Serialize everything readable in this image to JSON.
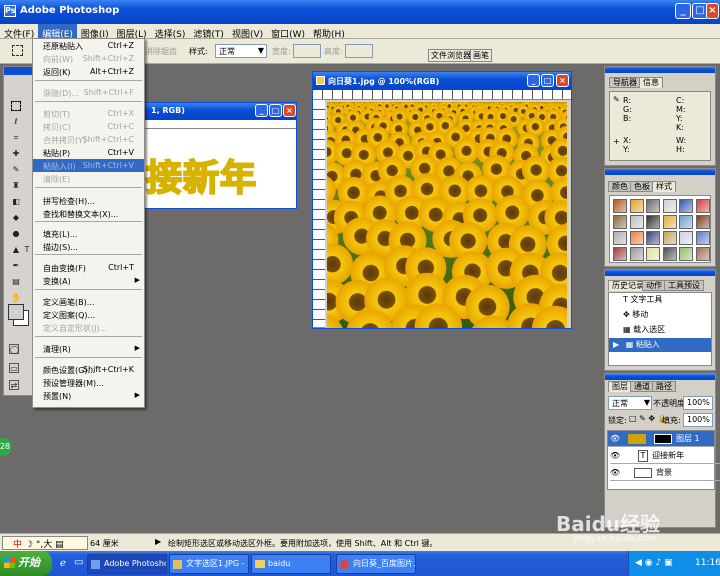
{
  "window": {
    "title": "Adobe Photoshop"
  },
  "menubar": [
    "文件(F)",
    "编辑(E)",
    "图像(I)",
    "图层(L)",
    "选择(S)",
    "滤镜(T)",
    "视图(V)",
    "窗口(W)",
    "帮助(H)"
  ],
  "options": {
    "feather_label": "消除锯齿",
    "style_label": "样式:",
    "style_value": "正常",
    "width_label": "宽度:",
    "height_label": "高度:",
    "tab1": "文件浏览器",
    "tab2": "画笔"
  },
  "edit_menu": [
    {
      "label": "还原粘贴入",
      "shortcut": "Ctrl+Z",
      "state": "normal"
    },
    {
      "label": "向前(W)",
      "shortcut": "Shift+Ctrl+Z",
      "state": "disabled"
    },
    {
      "label": "返回(K)",
      "shortcut": "Alt+Ctrl+Z",
      "state": "normal"
    },
    {
      "label": "渐隐(D)...",
      "shortcut": "Shift+Ctrl+F",
      "state": "disabled"
    },
    {
      "label": "剪切(T)",
      "shortcut": "Ctrl+X",
      "state": "disabled"
    },
    {
      "label": "拷贝(C)",
      "shortcut": "Ctrl+C",
      "state": "disabled"
    },
    {
      "label": "合并拷贝(Y)",
      "shortcut": "Shift+Ctrl+C",
      "state": "disabled"
    },
    {
      "label": "粘贴(P)",
      "shortcut": "Ctrl+V",
      "state": "normal"
    },
    {
      "label": "粘贴入(I)",
      "shortcut": "Shift+Ctrl+V",
      "state": "highlight"
    },
    {
      "label": "清除(E)",
      "shortcut": "",
      "state": "disabled"
    },
    {
      "label": "拼写检查(H)...",
      "shortcut": "",
      "state": "normal"
    },
    {
      "label": "查找和替换文本(X)...",
      "shortcut": "",
      "state": "normal"
    },
    {
      "label": "填充(L)...",
      "shortcut": "",
      "state": "normal"
    },
    {
      "label": "描边(S)...",
      "shortcut": "",
      "state": "normal"
    },
    {
      "label": "自由变换(F)",
      "shortcut": "Ctrl+T",
      "state": "normal"
    },
    {
      "label": "变换(A)",
      "shortcut": "",
      "state": "submenu"
    },
    {
      "label": "定义画笔(B)...",
      "shortcut": "",
      "state": "normal"
    },
    {
      "label": "定义图案(Q)...",
      "shortcut": "",
      "state": "normal"
    },
    {
      "label": "定义自定形状(J)...",
      "shortcut": "",
      "state": "disabled"
    },
    {
      "label": "清理(R)",
      "shortcut": "",
      "state": "submenu"
    },
    {
      "label": "颜色设置(G)...",
      "shortcut": "Shift+Ctrl+K",
      "state": "normal"
    },
    {
      "label": "预设管理器(M)...",
      "shortcut": "",
      "state": "normal"
    },
    {
      "label": "预置(N)",
      "shortcut": "",
      "state": "submenu"
    }
  ],
  "doc1": {
    "title_fragment": "1, RGB)",
    "art_text": "接新年"
  },
  "doc2": {
    "title": "向日葵1.jpg @ 100%(RGB)"
  },
  "navigator": {
    "tab1": "导航器",
    "tab2": "信息",
    "r": "R:",
    "g": "G:",
    "b": "B:",
    "c": "C:",
    "m": "M:",
    "y": "Y:",
    "k": "K:",
    "x": "X:",
    "yy": "Y:",
    "w": "W:",
    "h": "H:"
  },
  "swatches": {
    "tab1": "颜色",
    "tab2": "色板",
    "tab3": "样式"
  },
  "history": {
    "tab1": "历史记录",
    "tab2": "动作",
    "tab3": "工具预设",
    "items": [
      "文字工具",
      "移动",
      "载入选区",
      "粘贴入"
    ]
  },
  "layers": {
    "tab1": "图层",
    "tab2": "通道",
    "tab3": "路径",
    "mode": "正常",
    "opacity_label": "不透明度:",
    "opacity": "100%",
    "lock_label": "锁定:",
    "fill_label": "填充:",
    "fill": "100%",
    "rows": [
      "图层 1",
      "迎接新年",
      "背景"
    ]
  },
  "status": {
    "zoom": "64 厘米",
    "hint": "绘制矩形选区或移动选区外框。要用附加选项，使用 Shift、Alt 和 Ctrl 键。"
  },
  "ime": {
    "label": "中",
    "items": [
      "°",
      "大"
    ]
  },
  "taskbar": {
    "start": "开始",
    "tasks": [
      "Adobe Photoshop",
      "文字选区1.JPG - ...",
      "baidu",
      "向日葵_百度图片..."
    ],
    "clock": "11:16"
  },
  "watermark": {
    "text": "Baidu经验",
    "url": "jingyan.baidu.com"
  },
  "side_badge": "28"
}
